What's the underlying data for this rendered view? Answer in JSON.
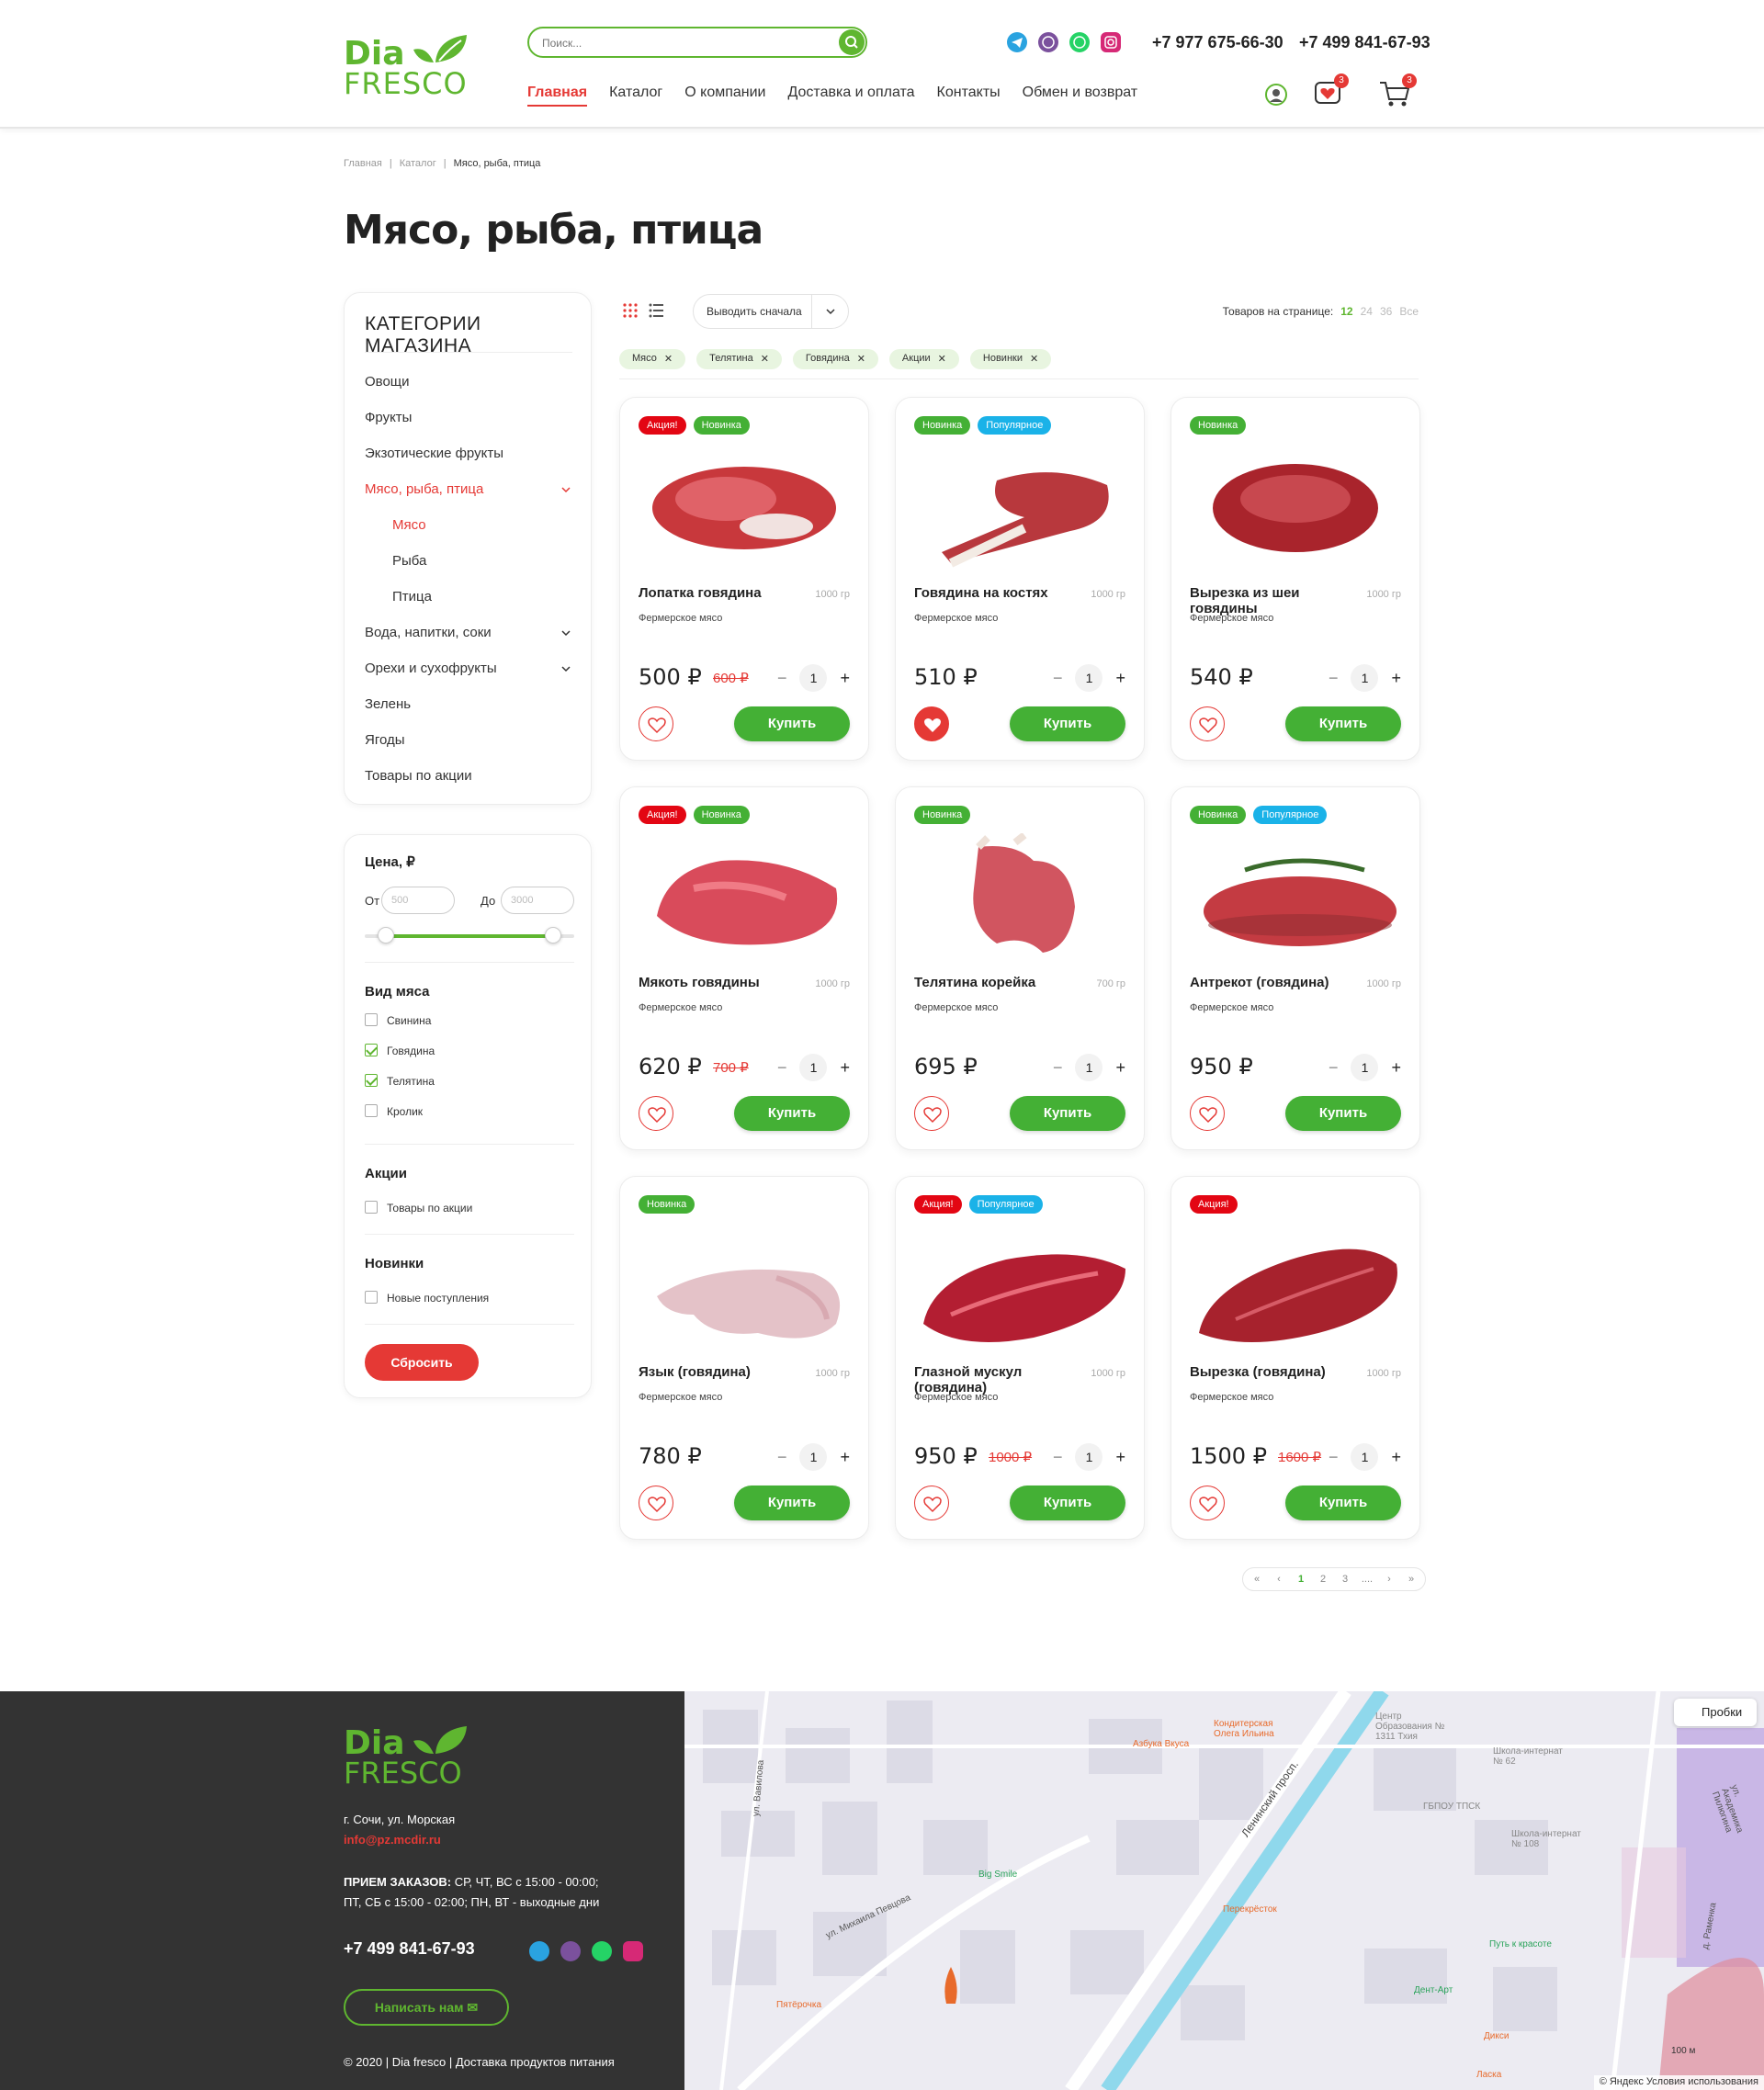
{
  "header": {
    "logo_top": "Dia",
    "logo_bottom": "FRESCO",
    "search_placeholder": "Поиск...",
    "phone1": "+7 977 675-66-30",
    "phone2": "+7 499 841-67-93",
    "nav": [
      "Главная",
      "Каталог",
      "О компании",
      "Доставка и оплата",
      "Контакты",
      "Обмен и возврат"
    ],
    "fav_count": "3",
    "cart_count": "3"
  },
  "breadcrumb": [
    "Главная",
    "Каталог",
    "Мясо, рыба, птица"
  ],
  "page_title": "Мясо, рыба, птица",
  "sidebar": {
    "title": "КАТЕГОРИИ МАГАЗИНА",
    "categories": [
      "Овощи",
      "Фрукты",
      "Экзотические фрукты",
      "Мясо, рыба, птица",
      "Мясо",
      "Рыба",
      "Птица",
      "Вода, напитки, соки",
      "Орехи и сухофрукты",
      "Зелень",
      "Ягоды",
      "Товары по акции"
    ]
  },
  "filter": {
    "price_title": "Цена, ₽",
    "from_label": "От",
    "to_label": "До",
    "from_placeholder": "500",
    "to_placeholder": "3000",
    "range_low": 0.1,
    "range_high": 0.9,
    "meat_title": "Вид мяса",
    "meat_options": [
      "Свинина",
      "Говядина",
      "Телятина",
      "Кролик"
    ],
    "meat_checked": [
      false,
      true,
      true,
      false
    ],
    "promo_title": "Акции",
    "promo_option": "Товары по акции",
    "new_title": "Новинки",
    "new_option": "Новые поступления",
    "reset_label": "Сбросить"
  },
  "toolbar": {
    "sort_label": "Выводить сначала",
    "per_page_label": "Товаров на странице:",
    "per_page_options": [
      "12",
      "24",
      "36",
      "Все"
    ],
    "tags": [
      "Мясо",
      "Телятина",
      "Говядина",
      "Акции",
      "Новинки"
    ]
  },
  "products": [
    {
      "name": "Лопатка говядина",
      "weight": "1000 гр",
      "desc": "Фермерское мясо",
      "price": "500 ₽",
      "old": "600 ₽",
      "qty": "1",
      "labels": [
        "Акция!",
        "Новинка"
      ],
      "fav": false,
      "buy": "Купить"
    },
    {
      "name": "Говядина на костях",
      "weight": "1000 гр",
      "desc": "Фермерское мясо",
      "price": "510 ₽",
      "old": "",
      "qty": "1",
      "labels": [
        "Новинка",
        "Популярное"
      ],
      "fav": true,
      "buy": "Купить"
    },
    {
      "name": "Вырезка из шеи говядины",
      "weight": "1000 гр",
      "desc": "Фермерское мясо",
      "price": "540 ₽",
      "old": "",
      "qty": "1",
      "labels": [
        "Новинка"
      ],
      "fav": false,
      "buy": "Купить"
    },
    {
      "name": "Мякоть говядины",
      "weight": "1000 гр",
      "desc": "Фермерское мясо",
      "price": "620 ₽",
      "old": "700 ₽",
      "qty": "1",
      "labels": [
        "Акция!",
        "Новинка"
      ],
      "fav": false,
      "buy": "Купить"
    },
    {
      "name": "Телятина корейка",
      "weight": "700 гр",
      "desc": "Фермерское мясо",
      "price": "695 ₽",
      "old": "",
      "qty": "1",
      "labels": [
        "Новинка"
      ],
      "fav": false,
      "buy": "Купить"
    },
    {
      "name": "Антрекот (говядина)",
      "weight": "1000 гр",
      "desc": "Фермерское мясо",
      "price": "950 ₽",
      "old": "",
      "qty": "1",
      "labels": [
        "Новинка",
        "Популярное"
      ],
      "fav": false,
      "buy": "Купить"
    },
    {
      "name": "Язык (говядина)",
      "weight": "1000 гр",
      "desc": "Фермерское мясо",
      "price": "780 ₽",
      "old": "",
      "qty": "1",
      "labels": [
        "Новинка"
      ],
      "fav": false,
      "buy": "Купить"
    },
    {
      "name": "Глазной мускул (говядина)",
      "weight": "1000 гр",
      "desc": "Фермерское мясо",
      "price": "950 ₽",
      "old": "1000 ₽",
      "qty": "1",
      "labels": [
        "Акция!",
        "Популярное"
      ],
      "fav": false,
      "buy": "Купить"
    },
    {
      "name": "Вырезка (говядина)",
      "weight": "1000 гр",
      "desc": "Фермерское мясо",
      "price": "1500 ₽",
      "old": "1600 ₽",
      "qty": "1",
      "labels": [
        "Акция!"
      ],
      "fav": false,
      "buy": "Купить"
    }
  ],
  "pagination": [
    "«",
    "‹",
    "1",
    "2",
    "3",
    "....",
    "›",
    "»"
  ],
  "footer": {
    "logo_top": "Dia",
    "logo_bottom": "FRESCO",
    "address": "г. Сочи, ул. Морская",
    "email": "info@pz.mcdir.ru",
    "hours_title": "ПРИЕМ ЗАКАЗОВ:",
    "hours_1": " СР, ЧТ, ВС с 15:00 - 00:00;",
    "hours_2": "ПТ, СБ с 15:00 - 02:00; ПН, ВТ - выходные дни",
    "phone": "+7 499 841-67-93",
    "write_label": "Написать нам",
    "copyright": "© 2020 | Dia fresco | Доставка продуктов питания"
  },
  "map": {
    "probki": "Пробки",
    "copyright": "© Яндекс Условия использования",
    "scale": "100 м",
    "labels": [
      "Азбука Вкуса",
      "Кондитерская Олега Ильина",
      "Центр Образования № 1311 Тхия",
      "Школа-интернат № 62",
      "Ленинский просп.",
      "ГБПОУ ТПСК",
      "Школа-интернат № 108",
      "Big Smile",
      "Перекрёсток",
      "ул. Михаила Певцова",
      "Путь к красоте",
      "Дент-Арт",
      "Пятёрочка",
      "Дикси",
      "Ласка",
      "ул. Вавилова",
      "д. Раменка",
      "ул. Академика Пилюгина"
    ]
  },
  "colors": {
    "green": "#44b035",
    "red": "#e53935",
    "blue": "#1ab2e8"
  }
}
